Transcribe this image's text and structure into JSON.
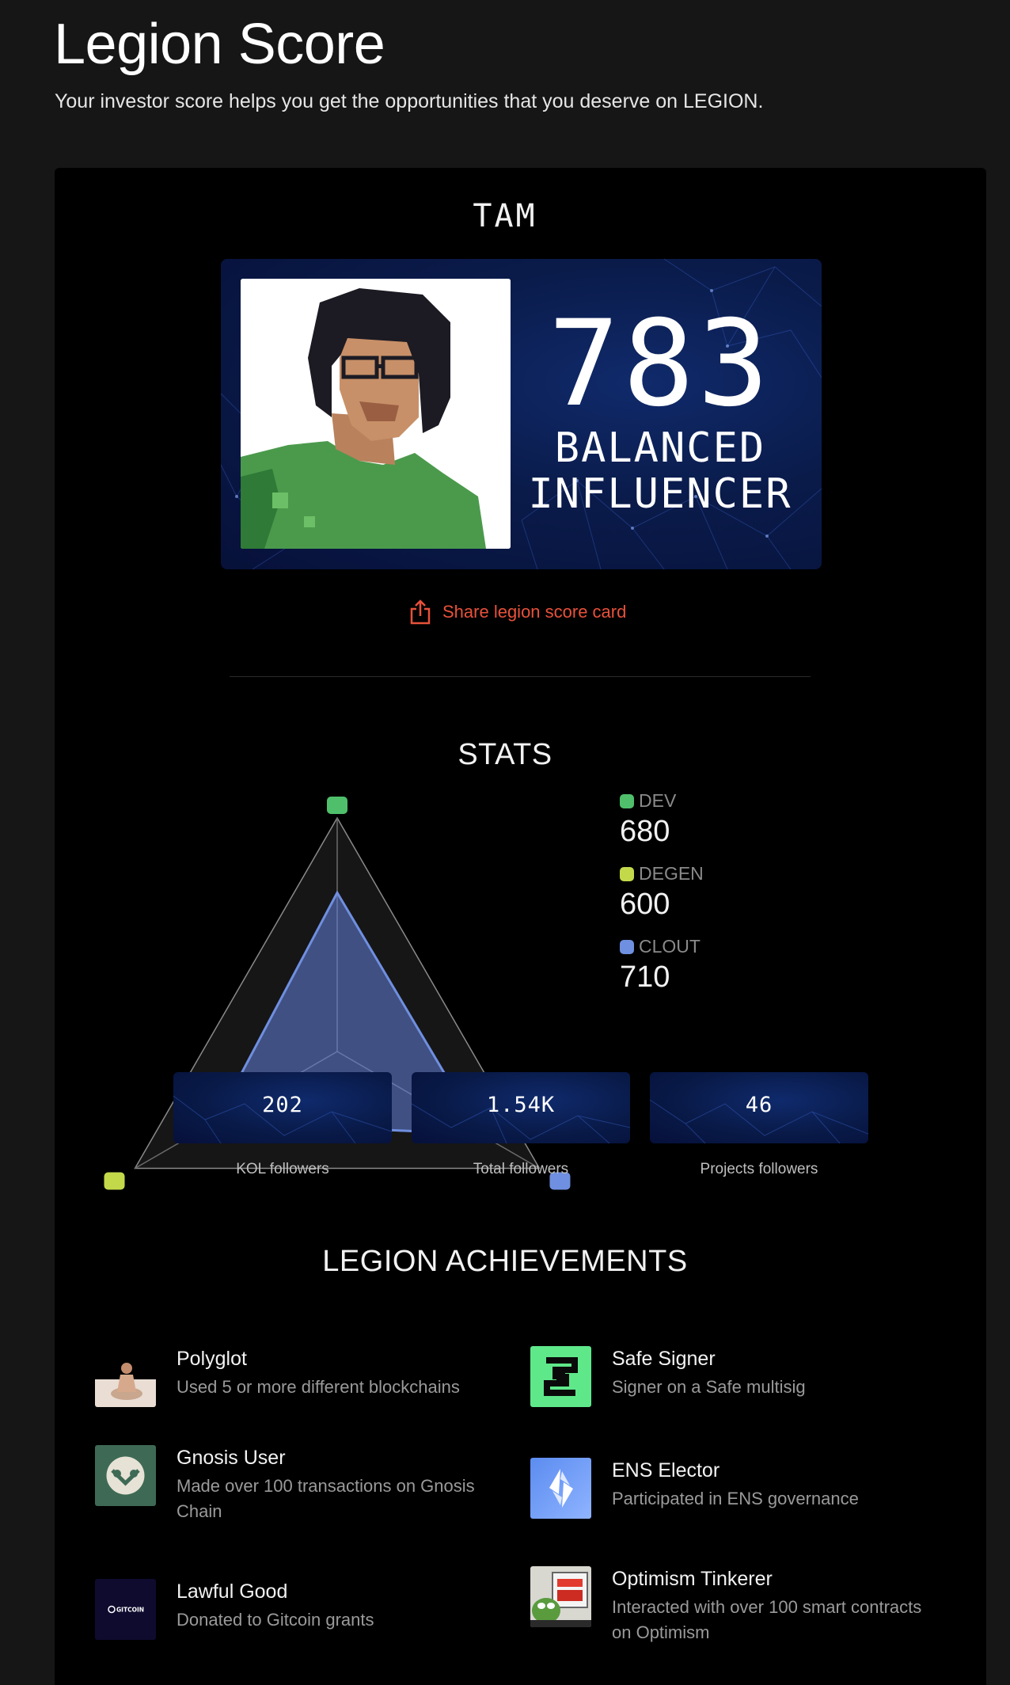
{
  "header": {
    "title": "Legion Score",
    "subtitle": "Your investor score helps you get the opportunities that you deserve on LEGION."
  },
  "profile": {
    "username": "TAM",
    "score": "783",
    "type_line1": "BALANCED",
    "type_line2": "INFLUENCER",
    "share_label": "Share legion score card"
  },
  "stats": {
    "title": "STATS",
    "legend": [
      {
        "name": "DEV",
        "value": "680",
        "color": "#4fbf6b"
      },
      {
        "name": "DEGEN",
        "value": "600",
        "color": "#c4d94a"
      },
      {
        "name": "CLOUT",
        "value": "710",
        "color": "#6f8fe0"
      }
    ]
  },
  "chart_data": {
    "type": "radar",
    "axes": [
      "DEV",
      "DEGEN",
      "CLOUT"
    ],
    "values": [
      680,
      600,
      710
    ],
    "colors": [
      "#4fbf6b",
      "#c4d94a",
      "#6f8fe0"
    ]
  },
  "followers": [
    {
      "value": "202",
      "label": "KOL followers"
    },
    {
      "value": "1.54K",
      "label": "Total followers"
    },
    {
      "value": "46",
      "label": "Projects followers"
    }
  ],
  "achievements": {
    "title": "LEGION ACHIEVEMENTS",
    "items": [
      {
        "title": "Polyglot",
        "desc": "Used 5 or more different blockchains",
        "icon": "polyglot-icon"
      },
      {
        "title": "Safe Signer",
        "desc": "Signer on a Safe multisig",
        "icon": "safe-icon"
      },
      {
        "title": "Gnosis User",
        "desc": "Made over 100 transactions on Gnosis Chain",
        "icon": "gnosis-icon"
      },
      {
        "title": "ENS Elector",
        "desc": "Participated in ENS governance",
        "icon": "ens-icon"
      },
      {
        "title": "Lawful Good",
        "desc": "Donated to Gitcoin grants",
        "icon": "gitcoin-icon",
        "icon_text": "GITCOIN"
      },
      {
        "title": "Optimism Tinkerer",
        "desc": "Interacted with over 100 smart contracts on Optimism",
        "icon": "optimism-icon"
      }
    ]
  }
}
